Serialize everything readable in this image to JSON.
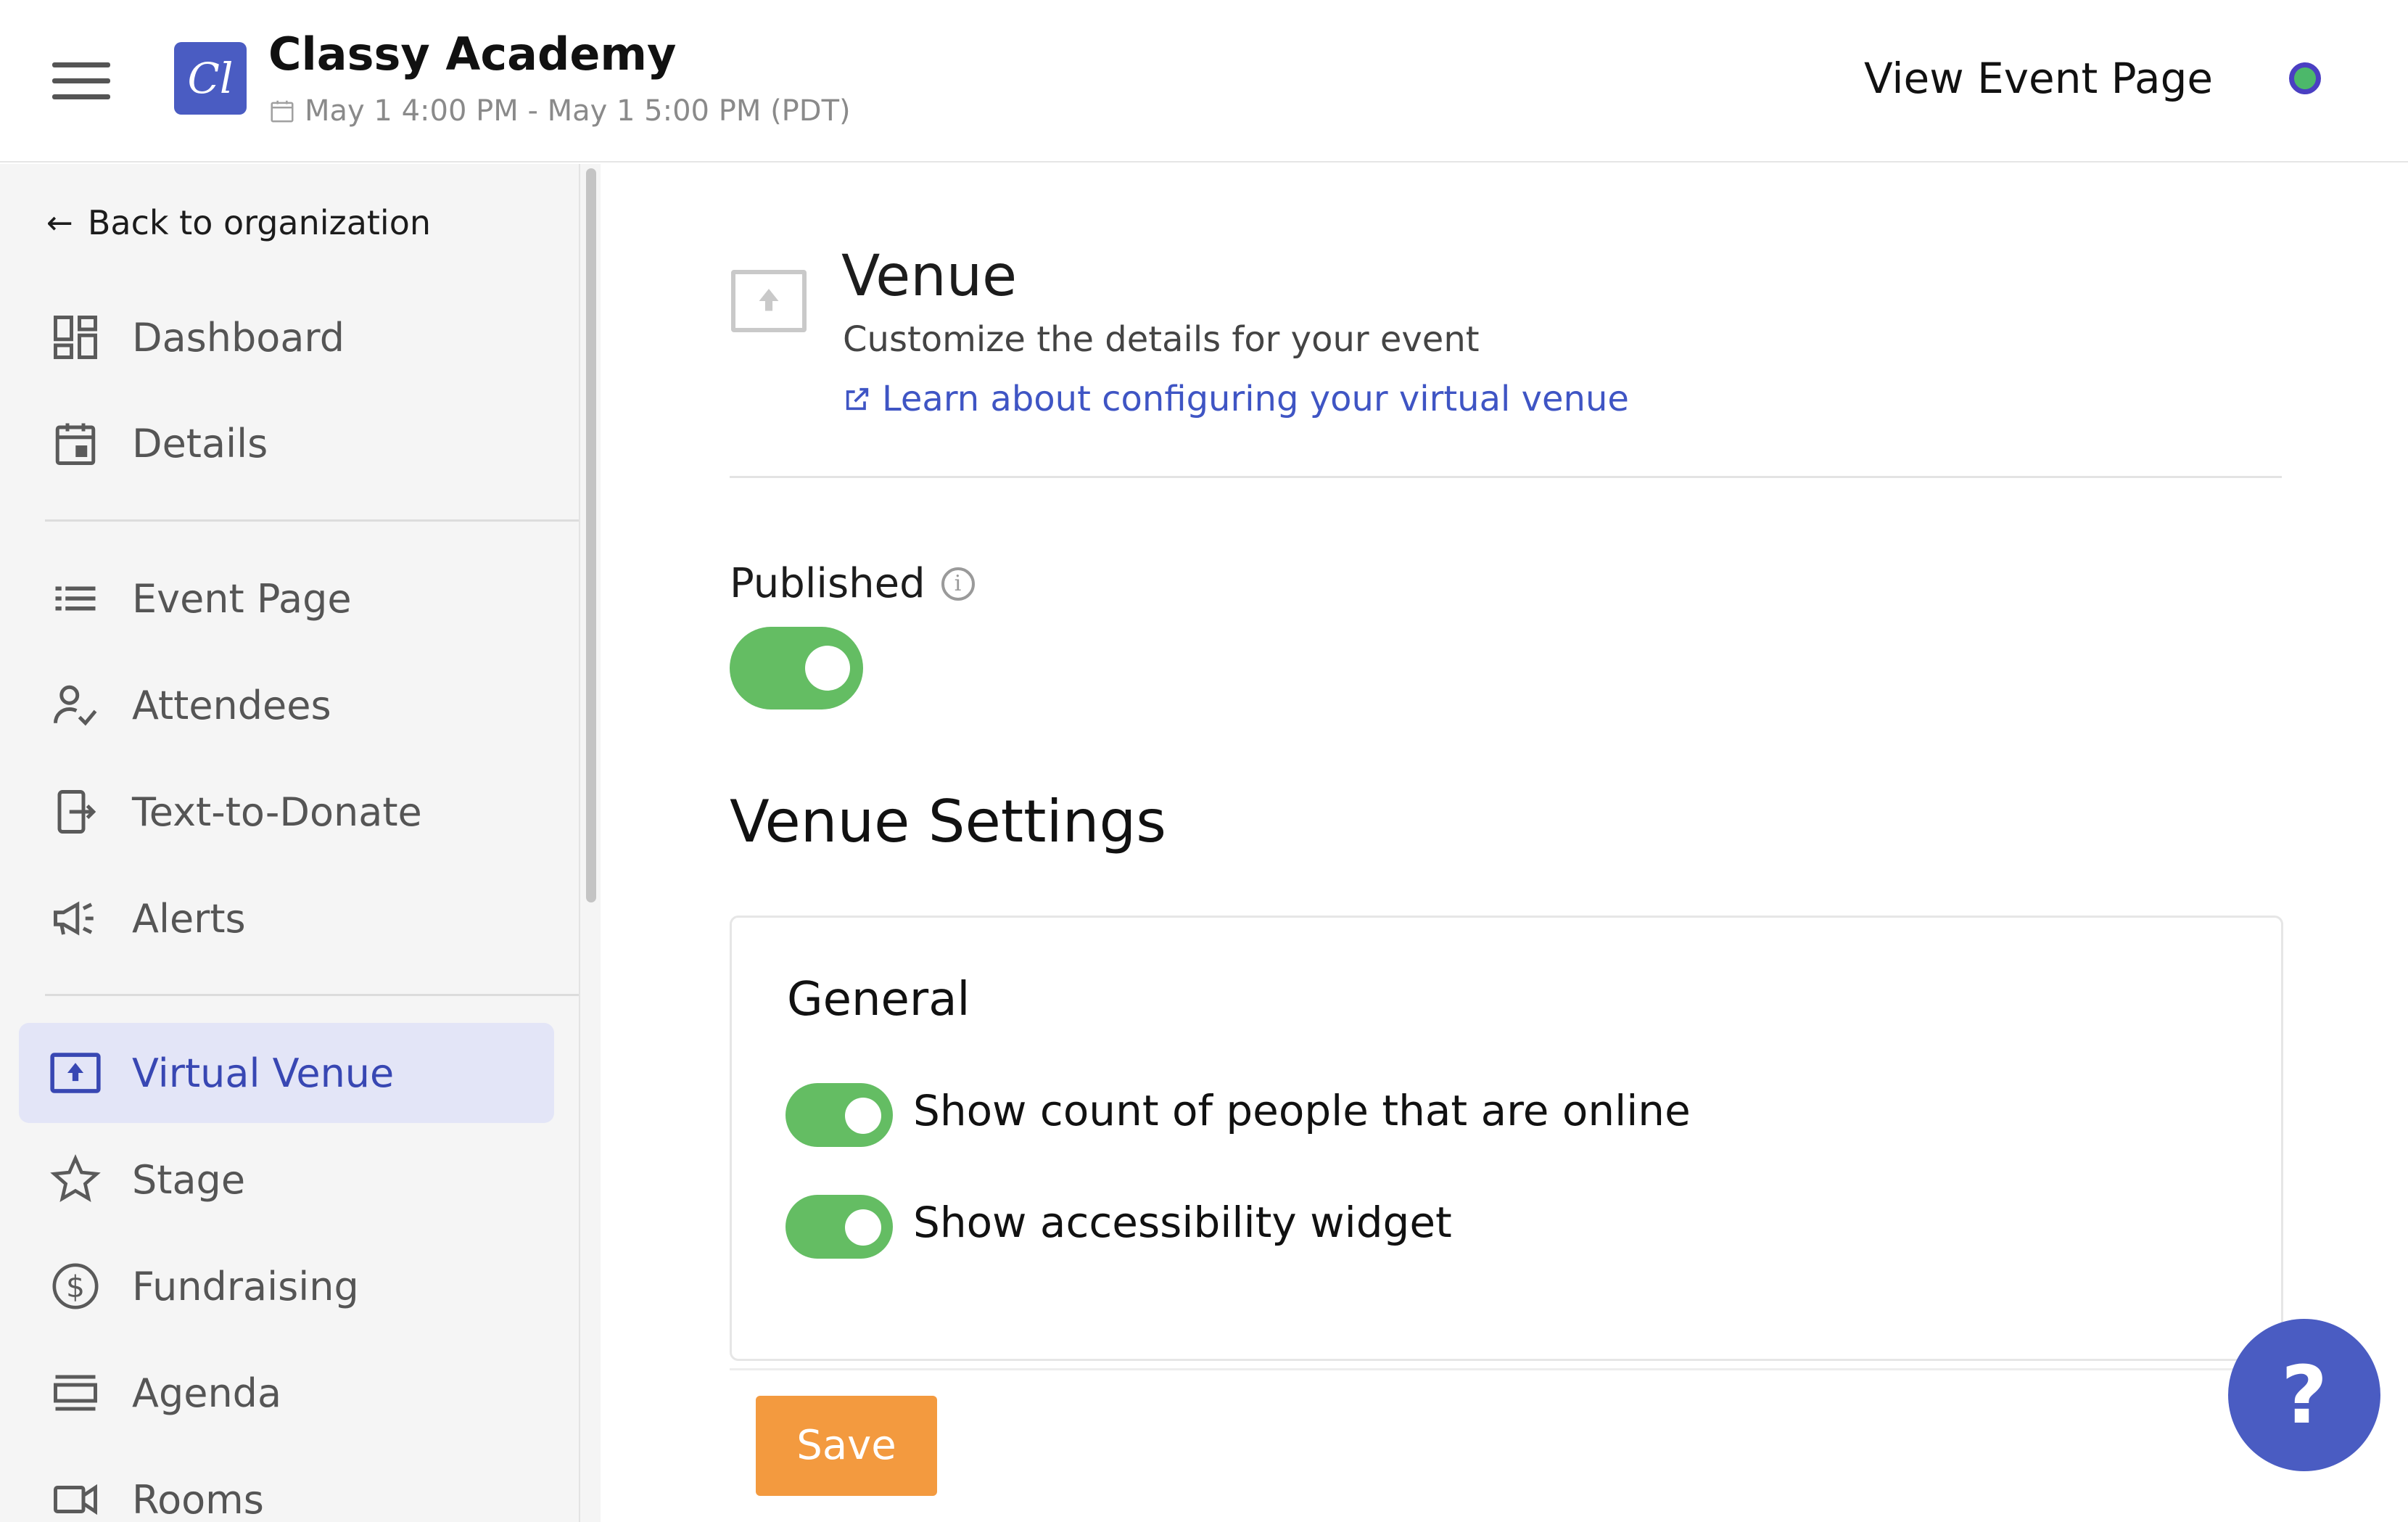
{
  "header": {
    "logo_text": "Cl",
    "org_name": "Classy Academy",
    "event_dates": "May 1 4:00 PM - May 1 5:00 PM (PDT)",
    "view_event_page": "View Event Page"
  },
  "sidebar": {
    "back_label": "Back to organization",
    "items": [
      {
        "label": "Dashboard",
        "icon": "dashboard-icon"
      },
      {
        "label": "Details",
        "icon": "calendar-icon"
      },
      {
        "label": "Event Page",
        "icon": "list-icon"
      },
      {
        "label": "Attendees",
        "icon": "person-check-icon"
      },
      {
        "label": "Text-to-Donate",
        "icon": "phone-share-icon"
      },
      {
        "label": "Alerts",
        "icon": "megaphone-icon"
      },
      {
        "label": "Virtual Venue",
        "icon": "upload-screen-icon",
        "active": true
      },
      {
        "label": "Stage",
        "icon": "star-icon"
      },
      {
        "label": "Fundraising",
        "icon": "dollar-icon"
      },
      {
        "label": "Agenda",
        "icon": "agenda-icon"
      },
      {
        "label": "Rooms",
        "icon": "video-camera-icon"
      }
    ]
  },
  "main": {
    "title": "Venue",
    "subtitle": "Customize the details for your event",
    "learn_link": "Learn about configuring your virtual venue",
    "published_label": "Published",
    "published": true,
    "settings_title": "Venue Settings",
    "general": {
      "title": "General",
      "options": [
        {
          "label": "Show count of people that are online",
          "enabled": true
        },
        {
          "label": "Show accessibility widget",
          "enabled": true
        }
      ]
    },
    "save_label": "Save",
    "help_label": "?"
  },
  "colors": {
    "brand": "#4a5cc2",
    "toggle_on": "#64bd63",
    "save": "#f39a3f",
    "link": "#3f55c4",
    "active_nav_bg": "#e3e5f7"
  }
}
